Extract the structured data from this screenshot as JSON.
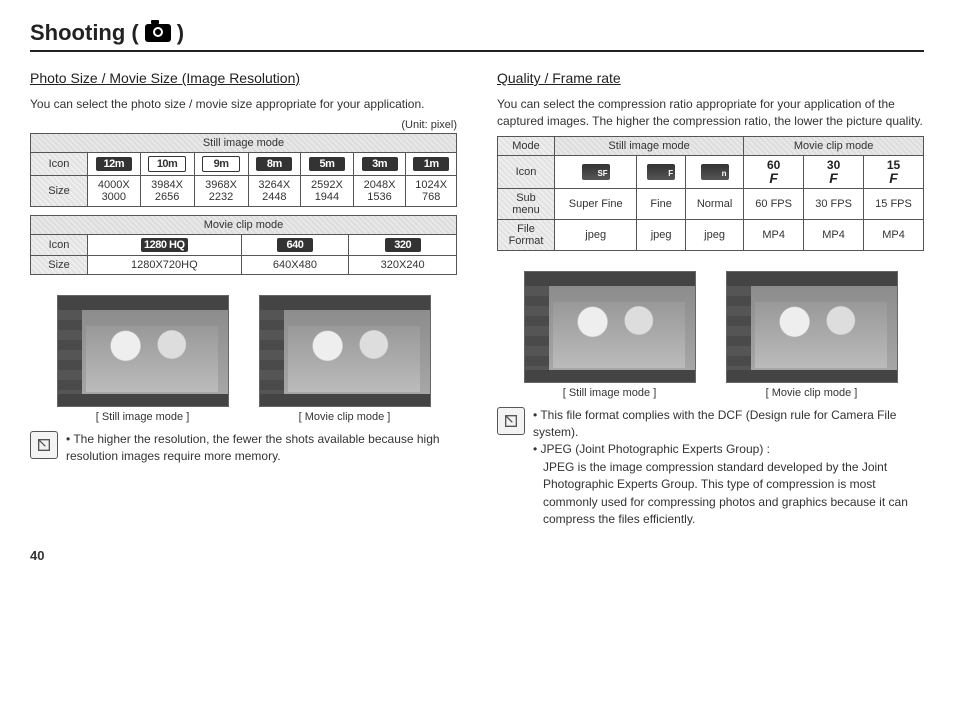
{
  "page_title_prefix": "Shooting (",
  "page_title_suffix": ")",
  "page_number": "40",
  "left": {
    "section_title": "Photo Size / Movie Size (Image Resolution)",
    "intro": "You can select the photo size / movie size appropriate for your application.",
    "unit_label": "(Unit: pixel)",
    "still_header": "Still image mode",
    "movie_header": "Movie clip mode",
    "row_icon_label": "Icon",
    "row_size_label": "Size",
    "still_icons": [
      "12m",
      "10m",
      "9m",
      "8m",
      "5m",
      "3m",
      "1m"
    ],
    "still_sizes": [
      "4000X 3000",
      "3984X 2656",
      "3968X 2232",
      "3264X 2448",
      "2592X 1944",
      "2048X 1536",
      "1024X 768"
    ],
    "movie_icons": [
      "1280 HQ",
      "640",
      "320"
    ],
    "movie_sizes": [
      "1280X720HQ",
      "640X480",
      "320X240"
    ],
    "shot1_caption": "[ Still image mode ]",
    "shot2_caption": "[ Movie clip mode ]",
    "note": "The higher the resolution, the fewer the shots available because high resolution images require more memory."
  },
  "right": {
    "section_title": "Quality / Frame rate",
    "intro": "You can select the compression ratio appropriate for your application of the captured images. The higher the compression ratio, the lower the picture quality.",
    "col_mode": "Mode",
    "col_still": "Still image mode",
    "col_movie": "Movie clip mode",
    "row_icon": "Icon",
    "row_sub": "Sub menu",
    "row_file": "File Format",
    "sub_menu": [
      "Super Fine",
      "Fine",
      "Normal",
      "60 FPS",
      "30 FPS",
      "15 FPS"
    ],
    "file_format": [
      "jpeg",
      "jpeg",
      "jpeg",
      "MP4",
      "MP4",
      "MP4"
    ],
    "fps_icons": [
      "60",
      "30",
      "15"
    ],
    "qual_icons": [
      "SF",
      "F",
      "n"
    ],
    "shot1_caption": "[ Still image mode ]",
    "shot2_caption": "[ Movie clip mode ]",
    "notes": [
      "This file format complies with the DCF (Design rule for Camera File system).",
      "JPEG (Joint Photographic Experts Group) :"
    ],
    "jpeg_detail": "JPEG is the image compression standard developed by the Joint Photographic Experts Group. This type of compression is most commonly used for compressing photos and graphics because it can compress the files efficiently."
  }
}
